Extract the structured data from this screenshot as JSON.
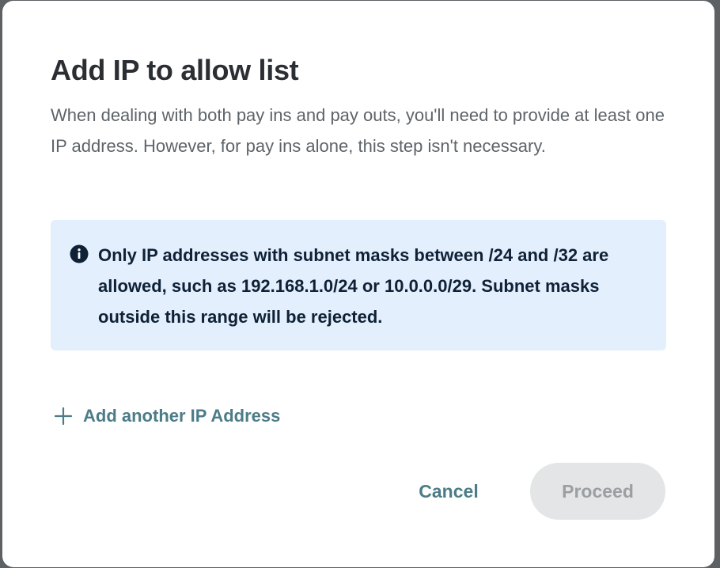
{
  "dialog": {
    "title": "Add IP to allow list",
    "description": "When dealing with both pay ins and pay outs, you'll need to provide at least one IP address. However, for pay ins alone, this step isn't necessary.",
    "info": {
      "icon": "info-icon",
      "text": "Only IP addresses with subnet masks between /24 and /32 are allowed, such as 192.168.1.0/24 or 10.0.0.0/29. Subnet masks outside this range will be rejected."
    },
    "add_ip": {
      "icon": "plus-icon",
      "label": "Add another IP Address"
    },
    "actions": {
      "cancel_label": "Cancel",
      "proceed_label": "Proceed",
      "proceed_disabled": true
    }
  },
  "colors": {
    "accent": "#4b7c87",
    "info_background": "#e3effc",
    "info_text": "#0f2137",
    "disabled_button_bg": "#e4e5e6",
    "disabled_button_text": "#9a9fa3"
  }
}
